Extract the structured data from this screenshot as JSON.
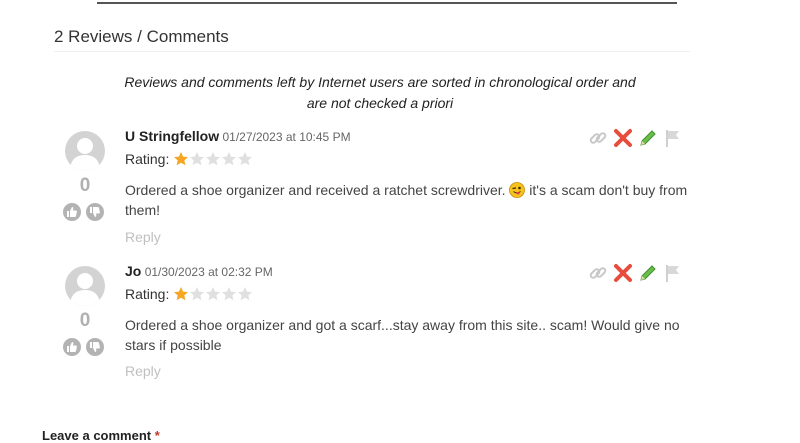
{
  "section": {
    "title": "2 Reviews / Comments",
    "notice_line1": "Reviews and comments left by Internet users are sorted in chronological order and",
    "notice_line2": "are not checked a priori"
  },
  "reviews": [
    {
      "author": "U Stringfellow",
      "date": "01/27/2023 at 10:45 PM",
      "rating_label": "Rating:",
      "rating": 1,
      "rating_max": 5,
      "score": "0",
      "text_before": "Ordered a shoe organizer and received a ratchet screwdriver. ",
      "text_after": " it's a scam don't buy from them!",
      "reply_label": "Reply"
    },
    {
      "author": "Jo",
      "date": "01/30/2023 at 02:32 PM",
      "rating_label": "Rating:",
      "rating": 1,
      "rating_max": 5,
      "score": "0",
      "text": "Ordered a shoe organizer and got a scarf...stay away from this site.. scam! Would give no stars if possible",
      "reply_label": "Reply"
    }
  ],
  "leave_comment": {
    "label": "Leave a comment ",
    "required_mark": "*"
  },
  "colors": {
    "star_filled": "#f5a623",
    "star_empty": "#e0e0e0",
    "delete": "#e74c3c",
    "edit": "#4caf50"
  },
  "icons": [
    "link-icon",
    "delete-icon",
    "edit-icon",
    "flag-icon",
    "thumbs-up-icon",
    "thumbs-down-icon"
  ]
}
